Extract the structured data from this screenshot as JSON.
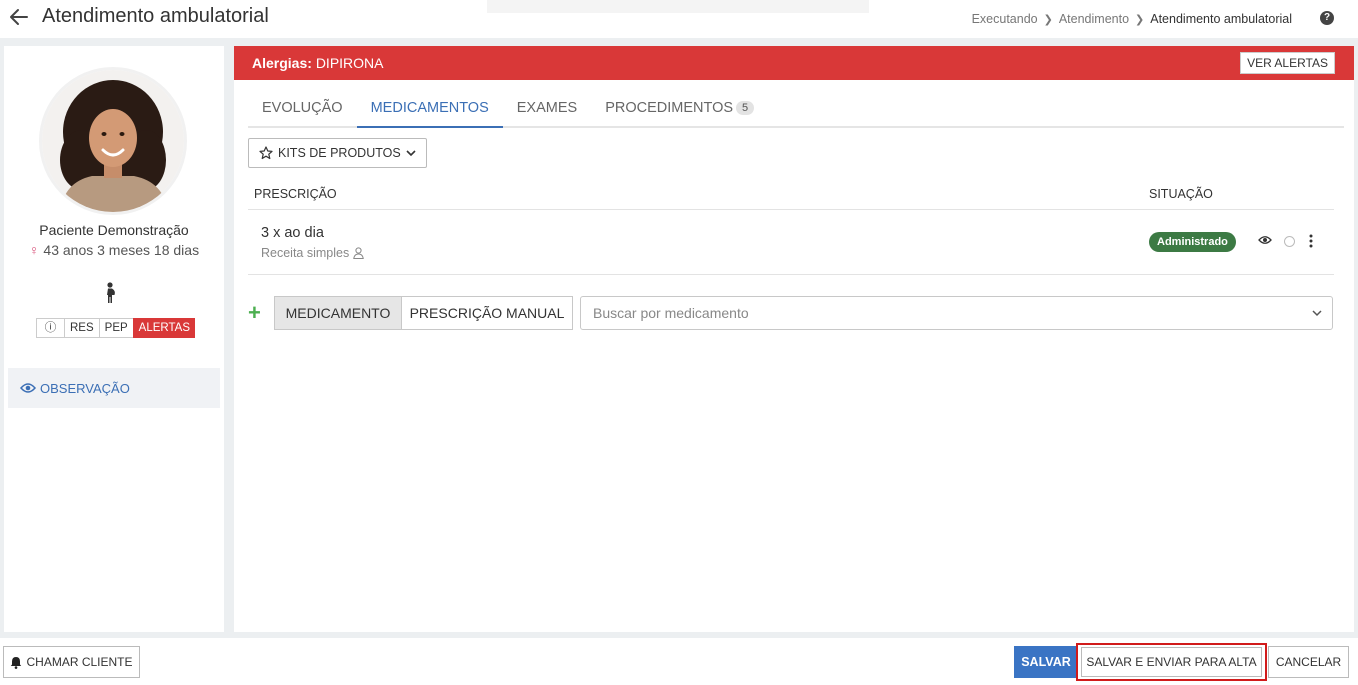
{
  "header": {
    "title": "Atendimento ambulatorial",
    "breadcrumb": [
      "Executando",
      "Atendimento",
      "Atendimento ambulatorial"
    ],
    "help_icon": "question-circle-icon"
  },
  "patient": {
    "name": "Paciente Demonstração",
    "sex_symbol": "♀",
    "age": "43 anos 3 meses 18 dias",
    "tags": [
      "RES",
      "PEP",
      "ALERTAS"
    ],
    "info_glyph": "ⓘ"
  },
  "sidebar": {
    "items": [
      {
        "label": "OBSERVAÇÃO",
        "icon": "eye-icon"
      }
    ]
  },
  "alert": {
    "label": "Alergias:",
    "value": "DIPIRONA",
    "button": "VER ALERTAS",
    "color": "#d93838"
  },
  "tabs": [
    {
      "label": "EVOLUÇÃO"
    },
    {
      "label": "MEDICAMENTOS",
      "active": true
    },
    {
      "label": "EXAMES"
    },
    {
      "label": "PROCEDIMENTOS",
      "badge": "5"
    }
  ],
  "kits_button": "KITS DE PRODUTOS",
  "table": {
    "columns": {
      "prescription": "PRESCRIÇÃO",
      "status": "SITUAÇÃO"
    },
    "rows": [
      {
        "title": "3 x ao dia",
        "subtitle": "Receita simples",
        "status": "Administrado"
      }
    ]
  },
  "add_section": {
    "medication_tab": "MEDICAMENTO",
    "manual_tab": "PRESCRIÇÃO MANUAL",
    "search_placeholder": "Buscar por medicamento"
  },
  "footer": {
    "call_client": "CHAMAR CLIENTE",
    "save": "SALVAR",
    "save_send": "SALVAR E ENVIAR PARA ALTA",
    "cancel": "CANCELAR"
  },
  "colors": {
    "primary": "#3a74c4",
    "success": "#3c7a44",
    "danger": "#d93838",
    "highlight": "#d11b1b"
  }
}
